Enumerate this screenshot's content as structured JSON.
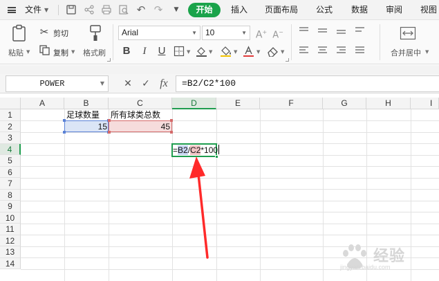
{
  "menubar": {
    "file_label": "文件",
    "tabs": [
      {
        "label": "开始",
        "active": true
      },
      {
        "label": "插入"
      },
      {
        "label": "页面布局"
      },
      {
        "label": "公式"
      },
      {
        "label": "数据"
      },
      {
        "label": "审阅"
      },
      {
        "label": "视图"
      }
    ],
    "quick_access": [
      "save-icon",
      "share-icon",
      "print-icon",
      "print-preview-icon",
      "undo-icon",
      "redo-icon",
      "more-icon"
    ]
  },
  "ribbon": {
    "paste_label": "粘贴",
    "cut_label": "剪切",
    "copy_label": "复制",
    "format_painter_label": "格式刷",
    "font_name": "Arial",
    "font_size": "10",
    "bold": "B",
    "italic": "I",
    "underline": "U",
    "merge_label": "合并居中"
  },
  "formula_bar": {
    "name_box": "POWER",
    "cancel_symbol": "✕",
    "enter_symbol": "✓",
    "fx_symbol": "fx",
    "formula": "=B2/C2*100"
  },
  "sheet": {
    "columns": [
      "A",
      "B",
      "C",
      "D",
      "E",
      "F",
      "G",
      "H",
      "I"
    ],
    "rows": [
      "1",
      "2",
      "3",
      "4",
      "5",
      "6",
      "7",
      "8",
      "9",
      "10",
      "11",
      "12",
      "13",
      "14"
    ],
    "active_cell": "D4",
    "cells": {
      "B1": "足球数量",
      "C1": "所有球类总数",
      "B2": "15",
      "C2": "45"
    },
    "edit_tokens": {
      "eq": "=",
      "ref1": "B2",
      "op1": "/",
      "ref2": "C2",
      "op2": "*100"
    }
  },
  "watermark": {
    "text_main": "经验",
    "text_sub": "jingyan.baidu.com"
  },
  "colors": {
    "accent_green": "#1aa34a",
    "ref_blue": "#5b82d6",
    "ref_red": "#d46a6a",
    "arrow_red": "#ff2a2a"
  }
}
